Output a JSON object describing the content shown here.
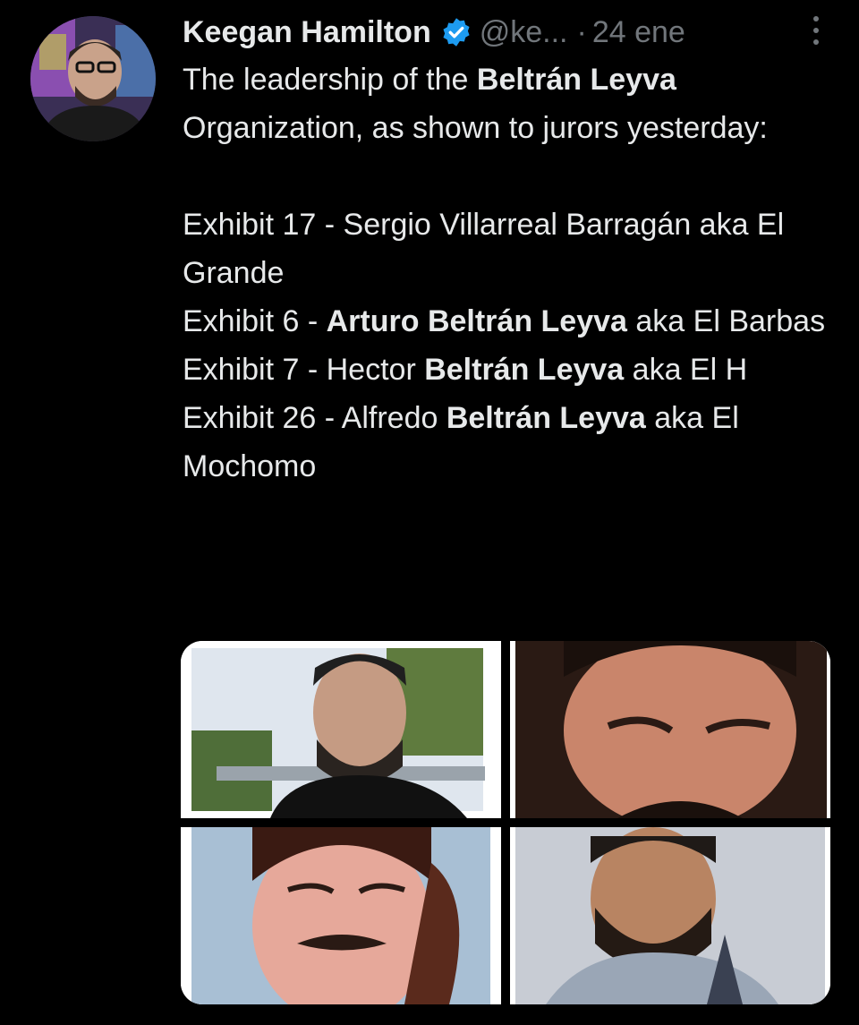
{
  "tweet": {
    "author_name": "Keegan Hamilton",
    "handle": "@ke...",
    "separator": "·",
    "date": "24 ene",
    "verified_icon": "verified-badge-icon",
    "more_icon": "more-options-icon",
    "text": {
      "intro_a": "The leadership of the ",
      "intro_b": "Beltrán Leyva",
      "intro_c": " Organization, as shown to jurors yesterday:",
      "line1": "Exhibit 17 - Sergio Villarreal Barragán aka El Grande",
      "line2_a": "Exhibit 6 - ",
      "line2_b": "Arturo Beltrán Leyva",
      "line2_c": " aka El Barbas",
      "line3_a": "Exhibit 7 - Hector ",
      "line3_b": "Beltrán Leyva",
      "line3_c": " aka El H",
      "line4_a": "Exhibit 26 - Alfredo ",
      "line4_b": "Beltrán Leyva",
      "line4_c": " aka El Mochomo"
    }
  },
  "colors": {
    "background": "#000000",
    "text_primary": "#e7e9ea",
    "text_secondary": "#71767b",
    "verified_blue": "#1d9bf0"
  },
  "media": {
    "count": 4
  }
}
